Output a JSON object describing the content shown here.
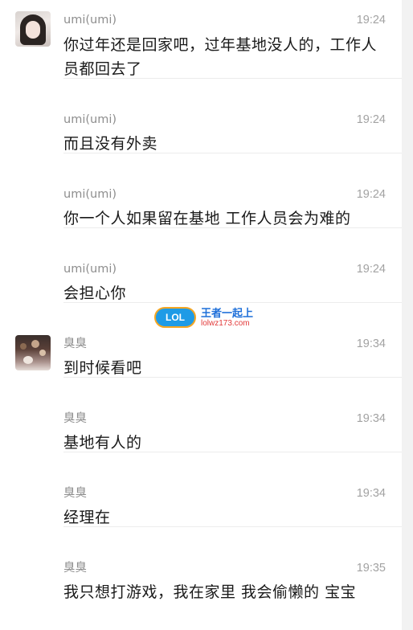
{
  "messages": [
    {
      "sender": "umi(umi)",
      "time": "19:24",
      "text": "你过年还是回家吧，过年基地没人的，工作人员都回去了"
    },
    {
      "sender": "umi(umi)",
      "time": "19:24",
      "text": "而且没有外卖"
    },
    {
      "sender": "umi(umi)",
      "time": "19:24",
      "text": "你一个人如果留在基地 工作人员会为难的"
    },
    {
      "sender": "umi(umi)",
      "time": "19:24",
      "text": "会担心你"
    },
    {
      "sender": "臭臭",
      "time": "19:34",
      "text": "到时候看吧"
    },
    {
      "sender": "臭臭",
      "time": "19:34",
      "text": "基地有人的"
    },
    {
      "sender": "臭臭",
      "time": "19:34",
      "text": "经理在"
    },
    {
      "sender": "臭臭",
      "time": "19:35",
      "text": "我只想打游戏，我在家里 我会偷懒的 宝宝"
    }
  ],
  "watermark": {
    "badge": "LOL",
    "brand": "王者一起上",
    "site": "lolwz173.com"
  }
}
